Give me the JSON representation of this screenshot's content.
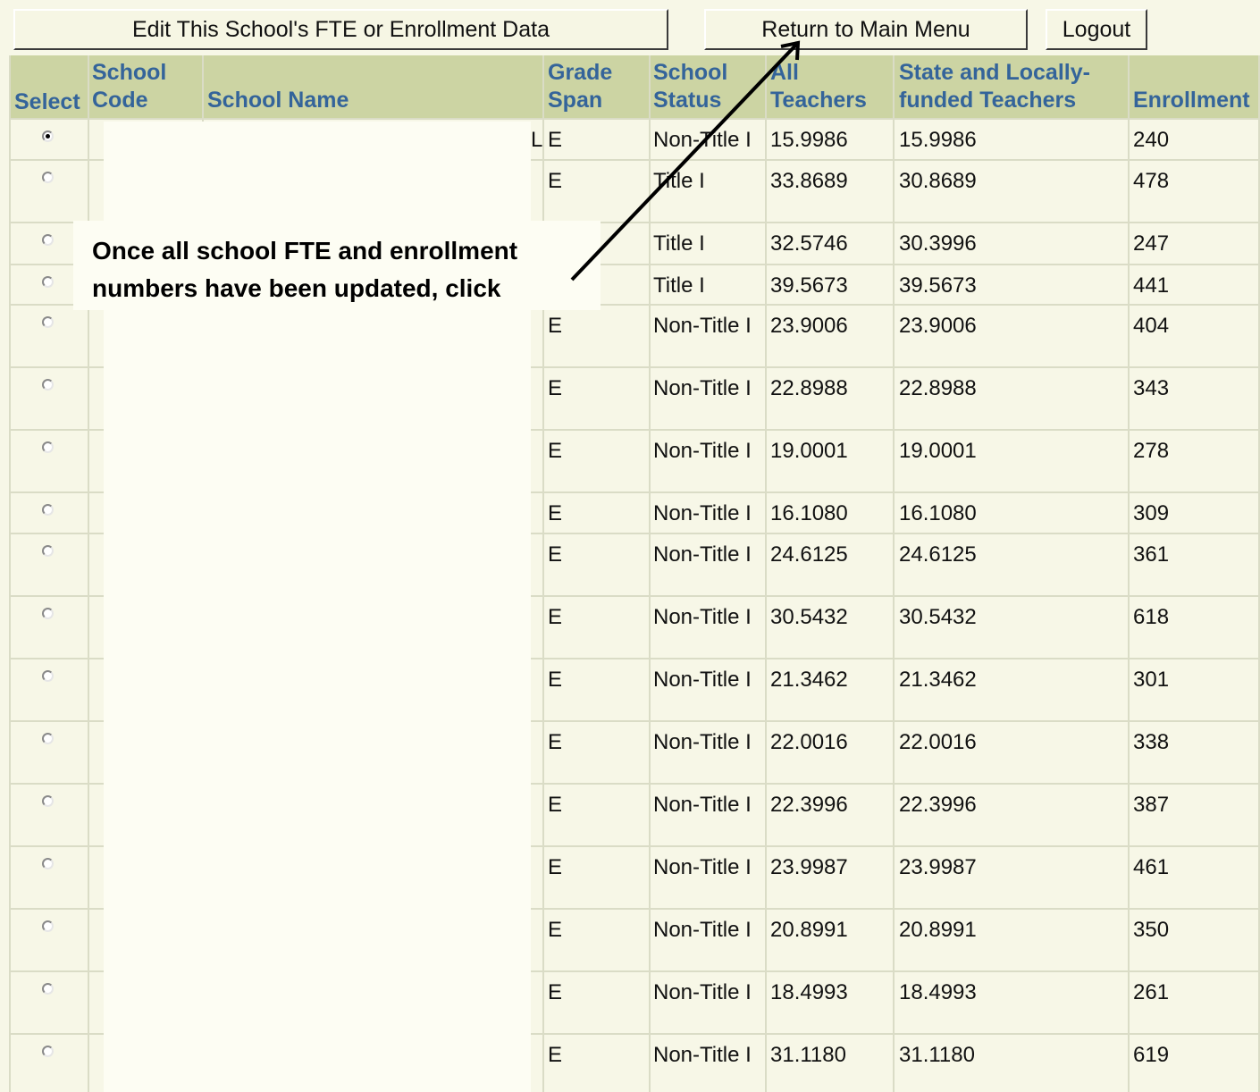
{
  "toolbar": {
    "edit_label": "Edit This School's FTE or Enrollment Data",
    "return_label": "Return to Main Menu",
    "logout_label": "Logout"
  },
  "table": {
    "headers": {
      "select": "Select",
      "code_line1": "School",
      "code_line2": "Code",
      "name": "School Name",
      "span_line1": "Grade",
      "span_line2": "Span",
      "status_line1": "School",
      "status_line2": "Status",
      "all_line1": "All",
      "all_line2": "Teachers",
      "state_line1": "State and Locally-",
      "state_line2": "funded Teachers",
      "enrollment": "Enrollment"
    },
    "rows": [
      {
        "selected": true,
        "name_fragment": "L",
        "span": "E",
        "status": "Non-Title I",
        "all": "15.9986",
        "state": "15.9986",
        "enrollment": "240"
      },
      {
        "selected": false,
        "name_fragment": "",
        "span": "E",
        "status": "Title I",
        "all": "33.8689",
        "state": "30.8689",
        "enrollment": "478"
      },
      {
        "selected": false,
        "name_fragment": "",
        "span": "",
        "status": "Title I",
        "all": "32.5746",
        "state": "30.3996",
        "enrollment": "247"
      },
      {
        "selected": false,
        "name_fragment": "",
        "span": "",
        "status": "Title I",
        "all": "39.5673",
        "state": "39.5673",
        "enrollment": "441"
      },
      {
        "selected": false,
        "name_fragment": "",
        "span": "E",
        "status": "Non-Title I",
        "all": "23.9006",
        "state": "23.9006",
        "enrollment": "404"
      },
      {
        "selected": false,
        "name_fragment": "",
        "span": "E",
        "status": "Non-Title I",
        "all": "22.8988",
        "state": "22.8988",
        "enrollment": "343"
      },
      {
        "selected": false,
        "name_fragment": "",
        "span": "E",
        "status": "Non-Title I",
        "all": "19.0001",
        "state": "19.0001",
        "enrollment": "278"
      },
      {
        "selected": false,
        "name_fragment": "",
        "span": "E",
        "status": "Non-Title I",
        "all": "16.1080",
        "state": "16.1080",
        "enrollment": "309"
      },
      {
        "selected": false,
        "name_fragment": "",
        "span": "E",
        "status": "Non-Title I",
        "all": "24.6125",
        "state": "24.6125",
        "enrollment": "361"
      },
      {
        "selected": false,
        "name_fragment": "",
        "span": "E",
        "status": "Non-Title I",
        "all": "30.5432",
        "state": "30.5432",
        "enrollment": "618"
      },
      {
        "selected": false,
        "name_fragment": "",
        "span": "E",
        "status": "Non-Title I",
        "all": "21.3462",
        "state": "21.3462",
        "enrollment": "301"
      },
      {
        "selected": false,
        "name_fragment": "",
        "span": "E",
        "status": "Non-Title I",
        "all": "22.0016",
        "state": "22.0016",
        "enrollment": "338"
      },
      {
        "selected": false,
        "name_fragment": "",
        "span": "E",
        "status": "Non-Title I",
        "all": "22.3996",
        "state": "22.3996",
        "enrollment": "387"
      },
      {
        "selected": false,
        "name_fragment": "",
        "span": "E",
        "status": "Non-Title I",
        "all": "23.9987",
        "state": "23.9987",
        "enrollment": "461"
      },
      {
        "selected": false,
        "name_fragment": "",
        "span": "E",
        "status": "Non-Title I",
        "all": "20.8991",
        "state": "20.8991",
        "enrollment": "350"
      },
      {
        "selected": false,
        "name_fragment": "",
        "span": "E",
        "status": "Non-Title I",
        "all": "18.4993",
        "state": "18.4993",
        "enrollment": "261"
      },
      {
        "selected": false,
        "name_fragment": "",
        "span": "E",
        "status": "Non-Title I",
        "all": "31.1180",
        "state": "31.1180",
        "enrollment": "619"
      }
    ]
  },
  "callout": {
    "line1": "Once all school FTE and enrollment",
    "line2": "numbers have been updated, click"
  },
  "colors": {
    "header_bg": "#ccd4a3",
    "header_text": "#34649a",
    "page_bg": "#f7f7e7"
  }
}
